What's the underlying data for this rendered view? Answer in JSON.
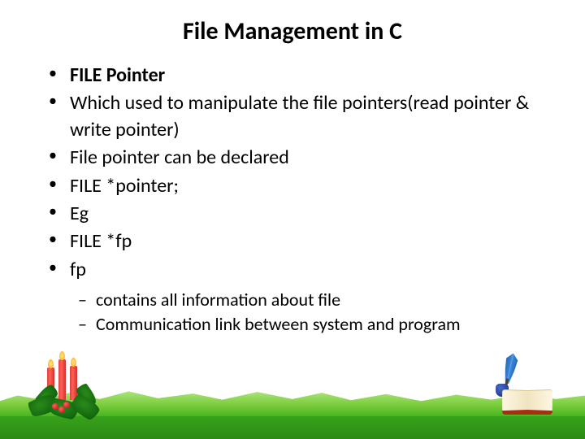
{
  "title": "File Management in C",
  "bullets": [
    {
      "text": "FILE Pointer",
      "bold": true
    },
    {
      "text": "Which used to manipulate the file pointers(read pointer & write pointer)",
      "bold": false
    },
    {
      "text": "File pointer can be declared",
      "bold": false
    },
    {
      "text": "FILE *pointer;",
      "bold": false
    },
    {
      "text": "Eg",
      "bold": false
    },
    {
      "text": "FILE *fp",
      "bold": false
    },
    {
      "text": "fp",
      "bold": false
    }
  ],
  "sub_bullets": [
    "contains all information about file",
    "Communication link between system and program"
  ],
  "decorations": {
    "bottom_left": "holly-candles",
    "bottom_right": "book-quill-inkpot",
    "ground": "grass-strip"
  }
}
